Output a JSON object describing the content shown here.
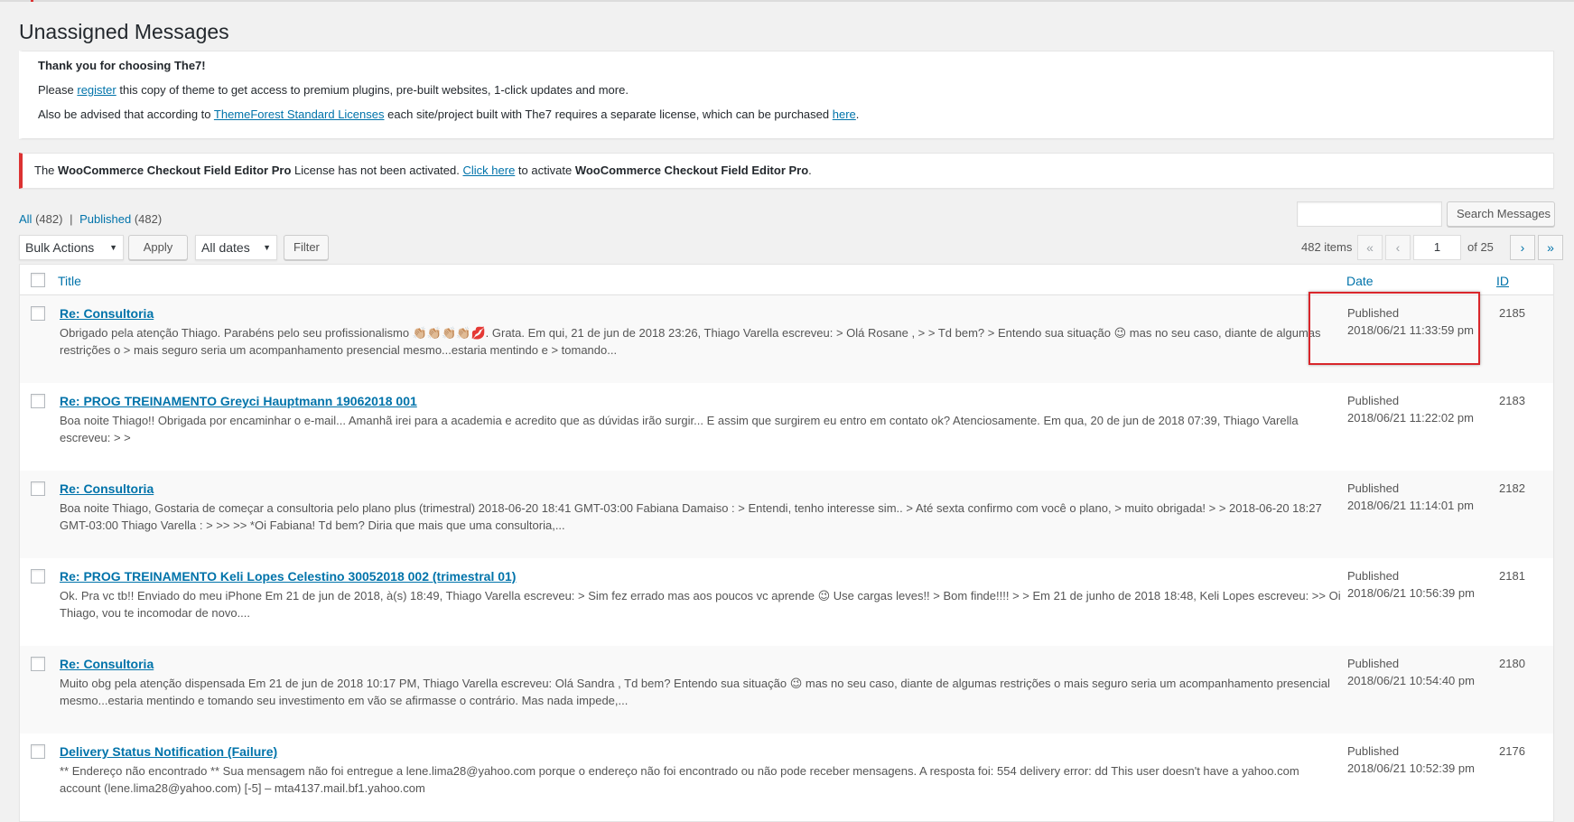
{
  "page": {
    "title": "Unassigned Messages"
  },
  "notices": {
    "theme": {
      "heading": "Thank you for choosing The7!",
      "line2_prefix": "Please",
      "register_link": "register",
      "line2_suffix": "this copy of theme to get access to premium plugins, pre-built websites, 1-click updates and more.",
      "line3_prefix": "Also be advised that according to",
      "licenses_link": "ThemeForest Standard Licenses",
      "line3_middle": "each site/project built with The7 requires a separate license, which can be purchased",
      "here_link": "here",
      "line3_suffix": "."
    },
    "license": {
      "prefix": "The",
      "product1": "WooCommerce Checkout Field Editor Pro",
      "middle": "License has not been activated.",
      "click_link": "Click here",
      "middle2": "to activate",
      "product2": "WooCommerce Checkout Field Editor Pro",
      "suffix": "."
    }
  },
  "views": {
    "all_label": "All",
    "all_count": "(482)",
    "separator": "|",
    "published_label": "Published",
    "published_count": "(482)"
  },
  "search": {
    "value": "",
    "button_label": "Search Messages"
  },
  "bulk": {
    "select_value": "Bulk Actions",
    "apply_label": "Apply",
    "dates_value": "All dates",
    "filter_label": "Filter"
  },
  "pagination": {
    "items": "482 items",
    "first": "«",
    "prev": "‹",
    "current": "1",
    "of": "of 25",
    "next": "›",
    "last": "»"
  },
  "table": {
    "headers": {
      "title": "Title",
      "date": "Date",
      "id": "ID"
    },
    "rows": [
      {
        "title": "Re: Consultoria",
        "excerpt": "Obrigado pela atenção Thiago. Parabéns pelo seu profissionalismo 👏🏼👏🏼👏🏼👏🏼💋. Grata. Em qui, 21 de jun de 2018 23:26, Thiago Varella escreveu: > Olá Rosane , > > Td bem? > Entendo sua situação 😉 mas no seu caso, diante de algumas restrições o > mais seguro seria um acompanhamento presencial mesmo...estaria mentindo e > tomando...",
        "status": "Published",
        "date": "2018/06/21 11:33:59 pm",
        "id": "2185"
      },
      {
        "title": "Re: PROG TREINAMENTO Greyci Hauptmann 19062018 001",
        "excerpt": "Boa noite Thiago!! Obrigada por encaminhar o e-mail... Amanhã irei para a academia e acredito que as dúvidas irão surgir... E assim que surgirem eu entro em contato ok? Atenciosamente. Em qua, 20 de jun de 2018 07:39, Thiago Varella escreveu: > >",
        "status": "Published",
        "date": "2018/06/21 11:22:02 pm",
        "id": "2183"
      },
      {
        "title": "Re: Consultoria",
        "excerpt": "Boa noite Thiago, Gostaria de começar a consultoria pelo plano plus (trimestral) 2018-06-20 18:41 GMT-03:00 Fabiana Damaiso : > Entendi, tenho interesse sim.. > Até sexta confirmo com você o plano, > muito obrigada! > > 2018-06-20 18:27 GMT-03:00 Thiago Varella : > >> >> *Oi Fabiana! Td bem? Diria que mais que uma consultoria,...",
        "status": "Published",
        "date": "2018/06/21 11:14:01 pm",
        "id": "2182"
      },
      {
        "title": "Re: PROG TREINAMENTO Keli Lopes Celestino 30052018 002 (trimestral 01)",
        "excerpt": "Ok. Pra vc tb!! Enviado do meu iPhone Em 21 de jun de 2018, à(s) 18:49, Thiago Varella escreveu: > Sim fez errado mas aos poucos vc aprende 😉 Use cargas leves!! > Bom finde!!!! > > Em 21 de junho de 2018 18:48, Keli Lopes escreveu: >> Oi Thiago, vou te incomodar de novo....",
        "status": "Published",
        "date": "2018/06/21 10:56:39 pm",
        "id": "2181"
      },
      {
        "title": "Re: Consultoria",
        "excerpt": "Muito obg pela atenção dispensada Em 21 de jun de 2018 10:17 PM, Thiago Varella escreveu: Olá Sandra , Td bem? Entendo sua situação 😉 mas no seu caso, diante de algumas restrições o mais seguro seria um acompanhamento presencial mesmo...estaria mentindo e tomando seu investimento em vão se afirmasse o contrário. Mas nada impede,...",
        "status": "Published",
        "date": "2018/06/21 10:54:40 pm",
        "id": "2180"
      },
      {
        "title": "Delivery Status Notification (Failure)",
        "excerpt": "** Endereço não encontrado ** Sua mensagem não foi entregue a lene.lima28@yahoo.com porque o endereço não foi encontrado ou não pode receber mensagens. A resposta foi: 554 delivery error: dd This user doesn't have a yahoo.com account (lene.lima28@yahoo.com) [-5] – mta4137.mail.bf1.yahoo.com",
        "status": "Published",
        "date": "2018/06/21 10:52:39 pm",
        "id": "2176"
      }
    ]
  },
  "colors": {
    "link": "#0073aa",
    "error_accent": "#dc3232",
    "highlight_box": "#d9262b",
    "background": "#f1f1f1"
  }
}
